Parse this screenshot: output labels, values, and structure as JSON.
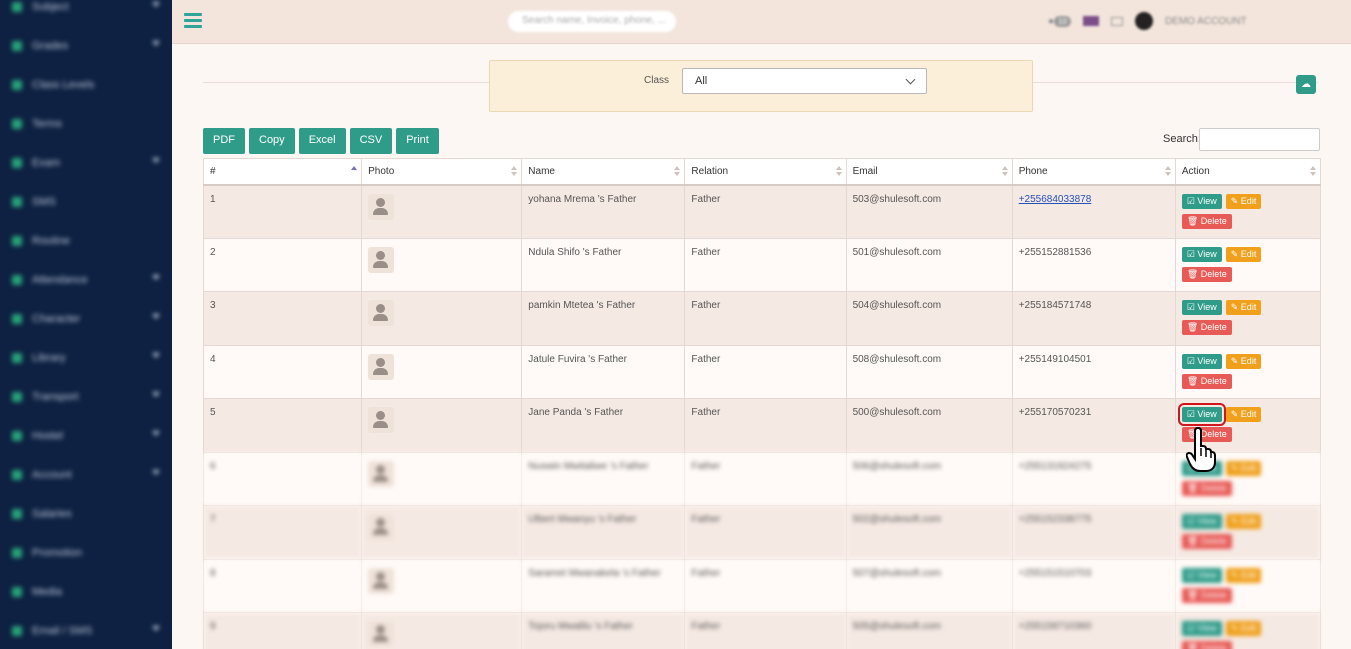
{
  "sidebar": {
    "items": [
      {
        "label": "Subject",
        "has_children": true
      },
      {
        "label": "Grades",
        "has_children": true
      },
      {
        "label": "Class Levels",
        "has_children": false
      },
      {
        "label": "Terms",
        "has_children": false
      },
      {
        "label": "Exam",
        "has_children": true
      },
      {
        "label": "SMS",
        "has_children": false
      },
      {
        "label": "Routine",
        "has_children": false
      },
      {
        "label": "Attendance",
        "has_children": true
      },
      {
        "label": "Character",
        "has_children": true
      },
      {
        "label": "Library",
        "has_children": true
      },
      {
        "label": "Transport",
        "has_children": true
      },
      {
        "label": "Hostel",
        "has_children": true
      },
      {
        "label": "Account",
        "has_children": true
      },
      {
        "label": "Salaries",
        "has_children": false
      },
      {
        "label": "Promotion",
        "has_children": false
      },
      {
        "label": "Media",
        "has_children": false
      },
      {
        "label": "Email / SMS",
        "has_children": true
      }
    ]
  },
  "topbar": {
    "search_placeholder": "Search name, Invoice, phone, ...",
    "notification_count": "10",
    "account_label": "DEMO ACCOUNT"
  },
  "filter": {
    "class_label": "Class",
    "class_value": "All"
  },
  "toolbar": {
    "buttons": [
      "PDF",
      "Copy",
      "Excel",
      "CSV",
      "Print"
    ],
    "search_label": "Search:"
  },
  "table": {
    "headers": [
      "#",
      "Photo",
      "Name",
      "Relation",
      "Email",
      "Phone",
      "Action"
    ],
    "action_labels": {
      "view": "☑ View",
      "edit": "✎ Edit",
      "delete": "🗑 Delete"
    },
    "rows": [
      {
        "num": "1",
        "name": "yohana Mrema 's Father",
        "relation": "Father",
        "email": "503@shulesoft.com",
        "phone": "+255684033878"
      },
      {
        "num": "2",
        "name": "Ndula Shifo 's Father",
        "relation": "Father",
        "email": "501@shulesoft.com",
        "phone": "+255152881536"
      },
      {
        "num": "3",
        "name": "pamkin Mtetea 's Father",
        "relation": "Father",
        "email": "504@shulesoft.com",
        "phone": "+255184571748"
      },
      {
        "num": "4",
        "name": "Jatule Fuvira 's Father",
        "relation": "Father",
        "email": "508@shulesoft.com",
        "phone": "+255149104501"
      },
      {
        "num": "5",
        "name": "Jane Panda 's Father",
        "relation": "Father",
        "email": "500@shulesoft.com",
        "phone": "+255170570231"
      },
      {
        "num": "6",
        "name": "Nuswin Mwitaliwe 's Father",
        "relation": "Father",
        "email": "506@shulesoft.com",
        "phone": "+255131924275"
      },
      {
        "num": "7",
        "name": "Ulbert Mwanyu 's Father",
        "relation": "Father",
        "email": "502@shulesoft.com",
        "phone": "+255152338775"
      },
      {
        "num": "8",
        "name": "Saramet Mwanakela 's Father",
        "relation": "Father",
        "email": "507@shulesoft.com",
        "phone": "+255151510703"
      },
      {
        "num": "9",
        "name": "Tojoru Mwalilu 's Father",
        "relation": "Father",
        "email": "505@shulesoft.com",
        "phone": "+255158710360"
      }
    ]
  },
  "colors": {
    "sidebar_bg": "#0e2142",
    "primary": "#2f9c8a",
    "edit": "#f0a01b",
    "delete": "#e85a56",
    "highlight": "#d0161e"
  }
}
